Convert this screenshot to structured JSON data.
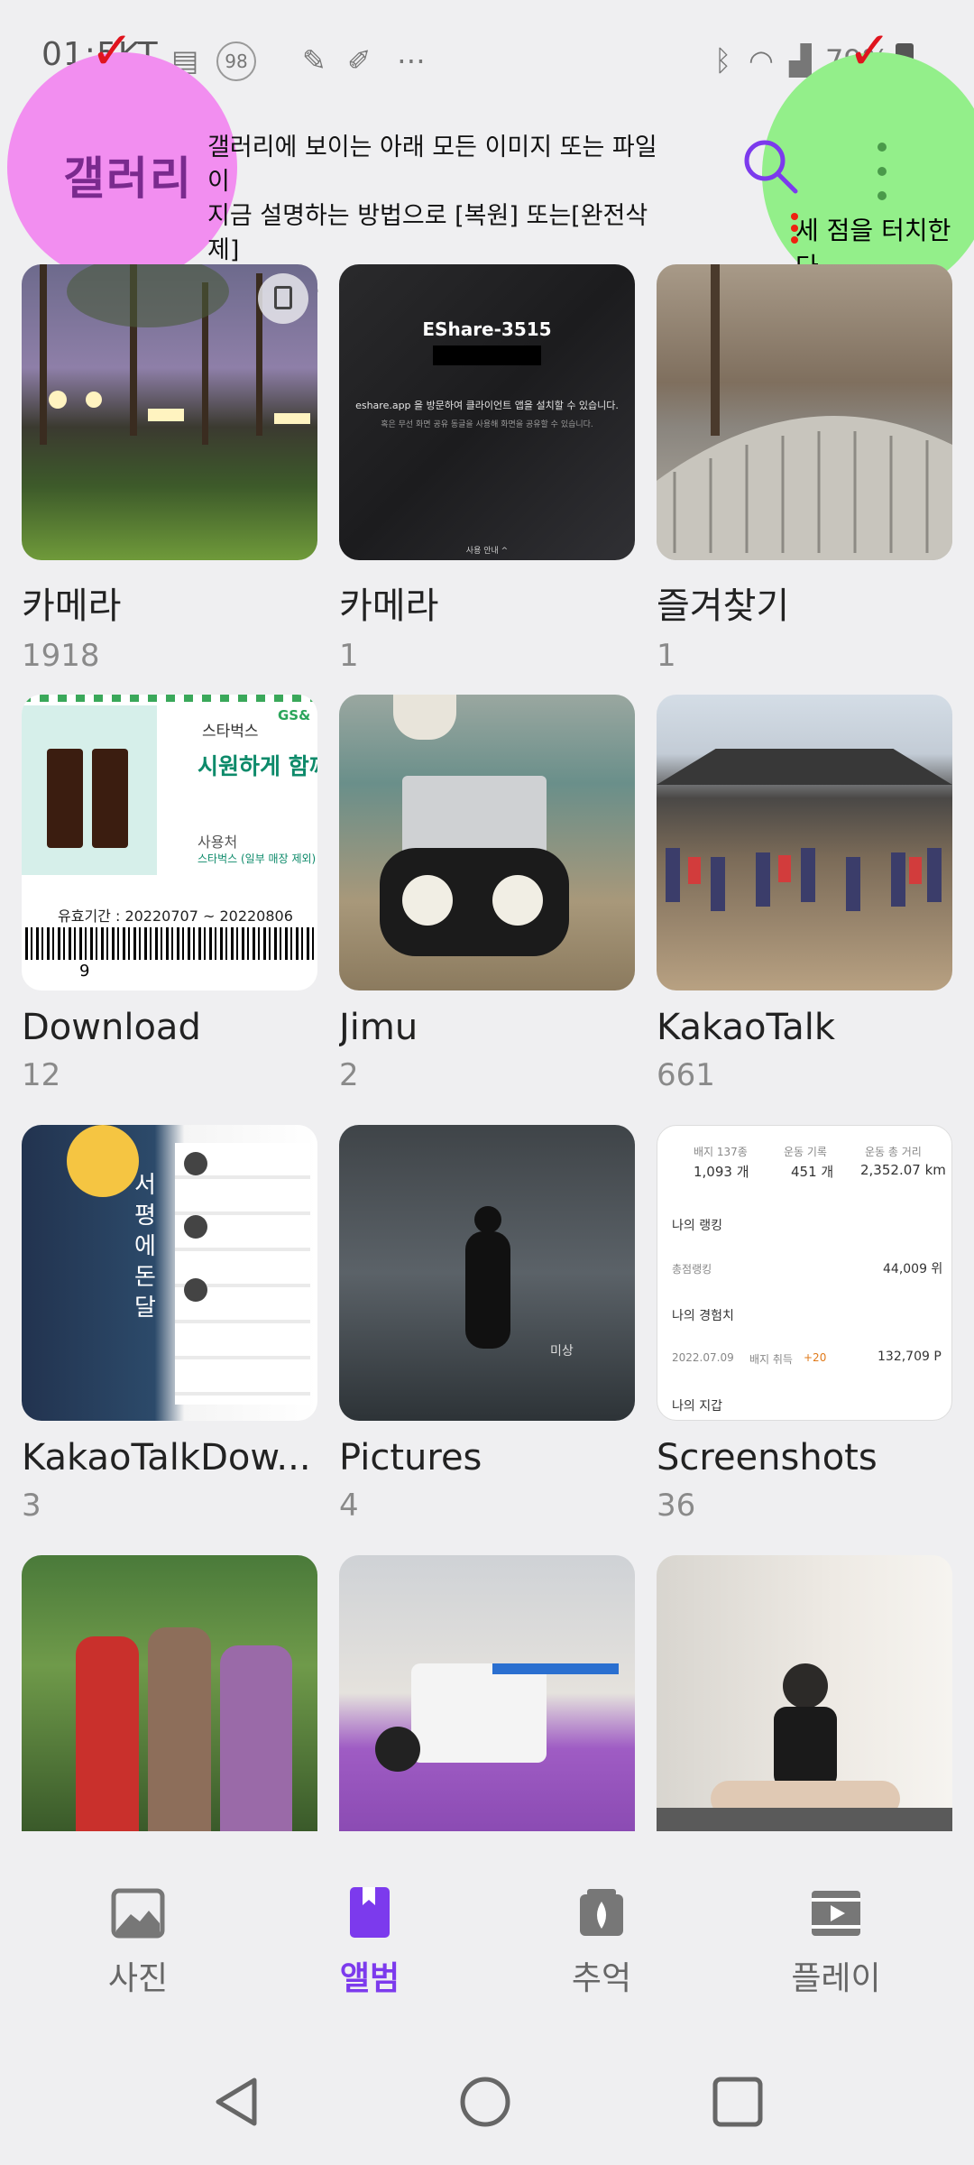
{
  "status_bar": {
    "time": "01:5",
    "carrier": "KT",
    "badge": "98",
    "battery": "79%"
  },
  "annotation": {
    "gallery_label": "갤러리",
    "note": "갤러리에 보이는 아래 모든 이미지 또는 파일이\n지금 설명하는 방법으로 [복원] 또는[완전삭제]\n할 수 있다.",
    "tap_note": "세 점을 터치한다",
    "check_mark": "✓"
  },
  "header": {
    "search_icon": "search-icon",
    "more_icon": "more-vert-icon"
  },
  "albums": [
    {
      "name": "카메라",
      "count": "1918"
    },
    {
      "name": "카메라",
      "count": "1"
    },
    {
      "name": "즐겨찾기",
      "count": "1"
    },
    {
      "name": "Download",
      "count": "12"
    },
    {
      "name": "Jimu",
      "count": "2"
    },
    {
      "name": "KakaoTalk",
      "count": "661"
    },
    {
      "name": "KakaoTalkDow...",
      "count": "3"
    },
    {
      "name": "Pictures",
      "count": "4"
    },
    {
      "name": "Screenshots",
      "count": "36"
    },
    {
      "name": "",
      "count": ""
    },
    {
      "name": "",
      "count": ""
    },
    {
      "name": "",
      "count": ""
    }
  ],
  "thumb_text": {
    "eshare_title": "EShare-3515",
    "eshare_line1": "eshare.app 을 방문하여 클라이언트 앱을 설치할 수 있습니다.",
    "eshare_line2": "혹은 무선 화면 공유 동글을 사용해 화면을 공유할 수 있습니다.",
    "eshare_bottom": "사용 안내 ^",
    "coupon_brand": "스타벅스",
    "coupon_gs": "GS&",
    "coupon_title": "시원하게 함께",
    "coupon_use": "사용처",
    "coupon_place": "스타벅스 (일부 매장 제외)",
    "coupon_valid": "유효기간 : 20220707 ~ 20220806",
    "coupon_num": "9",
    "kdown_title": "서평에 돈 달",
    "pictures_caption": "미상",
    "ss_badge": "배지 137종",
    "ss_badge_val": "1,093 개",
    "ss_record": "운동 기록",
    "ss_record_val": "451 개",
    "ss_dist": "운동 총 거리",
    "ss_dist_val": "2,352.07 km",
    "ss_rank": "나의 랭킹",
    "ss_total": "총점랭킹",
    "ss_total_val": "44,009 위",
    "ss_exp": "나의 경험치",
    "ss_exp_date": "2022.07.09",
    "ss_exp_item": "배지 취득",
    "ss_exp_plus": "+20",
    "ss_exp_val": "132,709 P",
    "ss_wallet": "나의 지갑"
  },
  "bottom_nav": [
    {
      "label": "사진",
      "icon": "photo-icon"
    },
    {
      "label": "앨범",
      "icon": "album-icon",
      "active": true
    },
    {
      "label": "추억",
      "icon": "memories-icon"
    },
    {
      "label": "플레이",
      "icon": "play-icon"
    }
  ],
  "colors": {
    "accent": "#7c3aed",
    "annotation_pink": "#f28ef0",
    "annotation_green": "#93ef8a",
    "check_red": "#e0141e"
  }
}
